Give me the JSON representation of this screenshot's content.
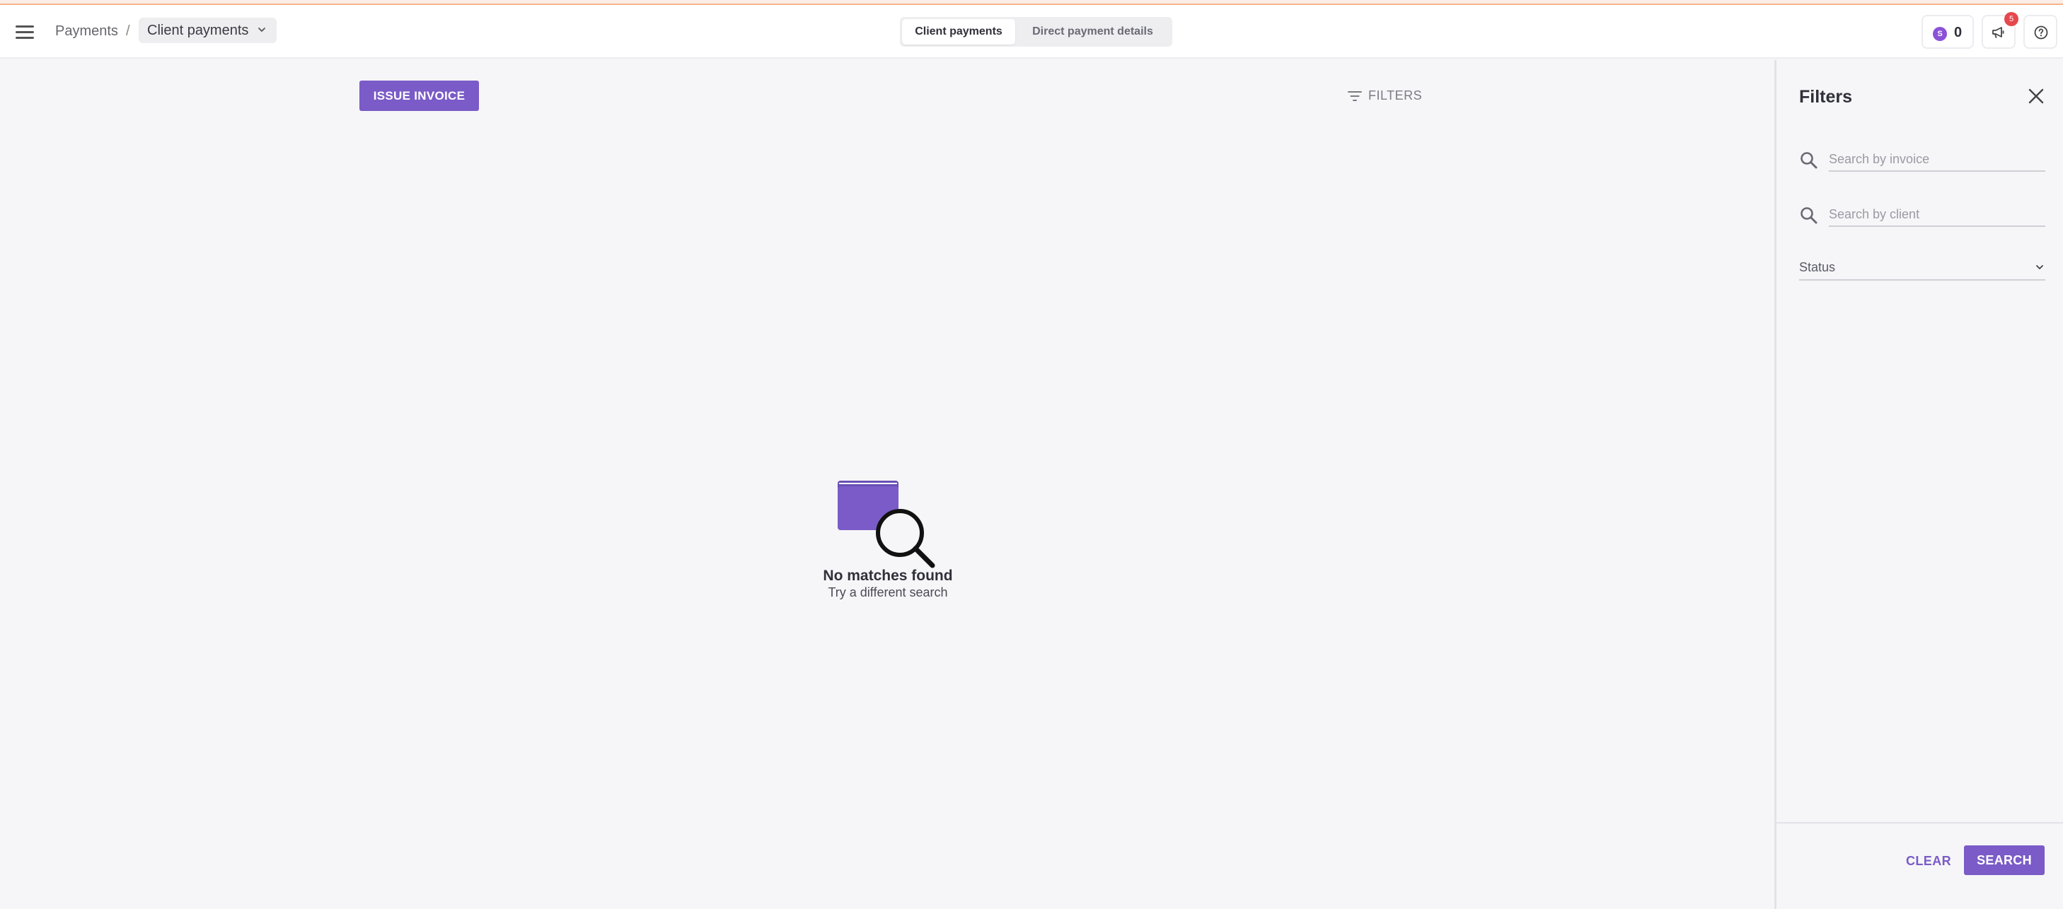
{
  "header": {
    "breadcrumb_root": "Payments",
    "breadcrumb_separator": "/",
    "breadcrumb_current": "Client payments",
    "tabs": [
      {
        "label": "Client payments",
        "active": true
      },
      {
        "label": "Direct payment details",
        "active": false
      }
    ],
    "credits": {
      "coin_symbol": "S",
      "value": "0"
    },
    "notifications_count": "5"
  },
  "main": {
    "issue_invoice_label": "ISSUE INVOICE",
    "filters_toggle_label": "FILTERS",
    "empty_state": {
      "title": "No matches found",
      "subtitle": "Try a different search"
    }
  },
  "filters_panel": {
    "title": "Filters",
    "invoice_search_placeholder": "Search by invoice",
    "client_search_placeholder": "Search by client",
    "status_label": "Status",
    "clear_label": "CLEAR",
    "search_label": "SEARCH"
  },
  "colors": {
    "accent": "#7a5bc7",
    "badge": "#e5484d",
    "coin": "#8b52d8"
  }
}
